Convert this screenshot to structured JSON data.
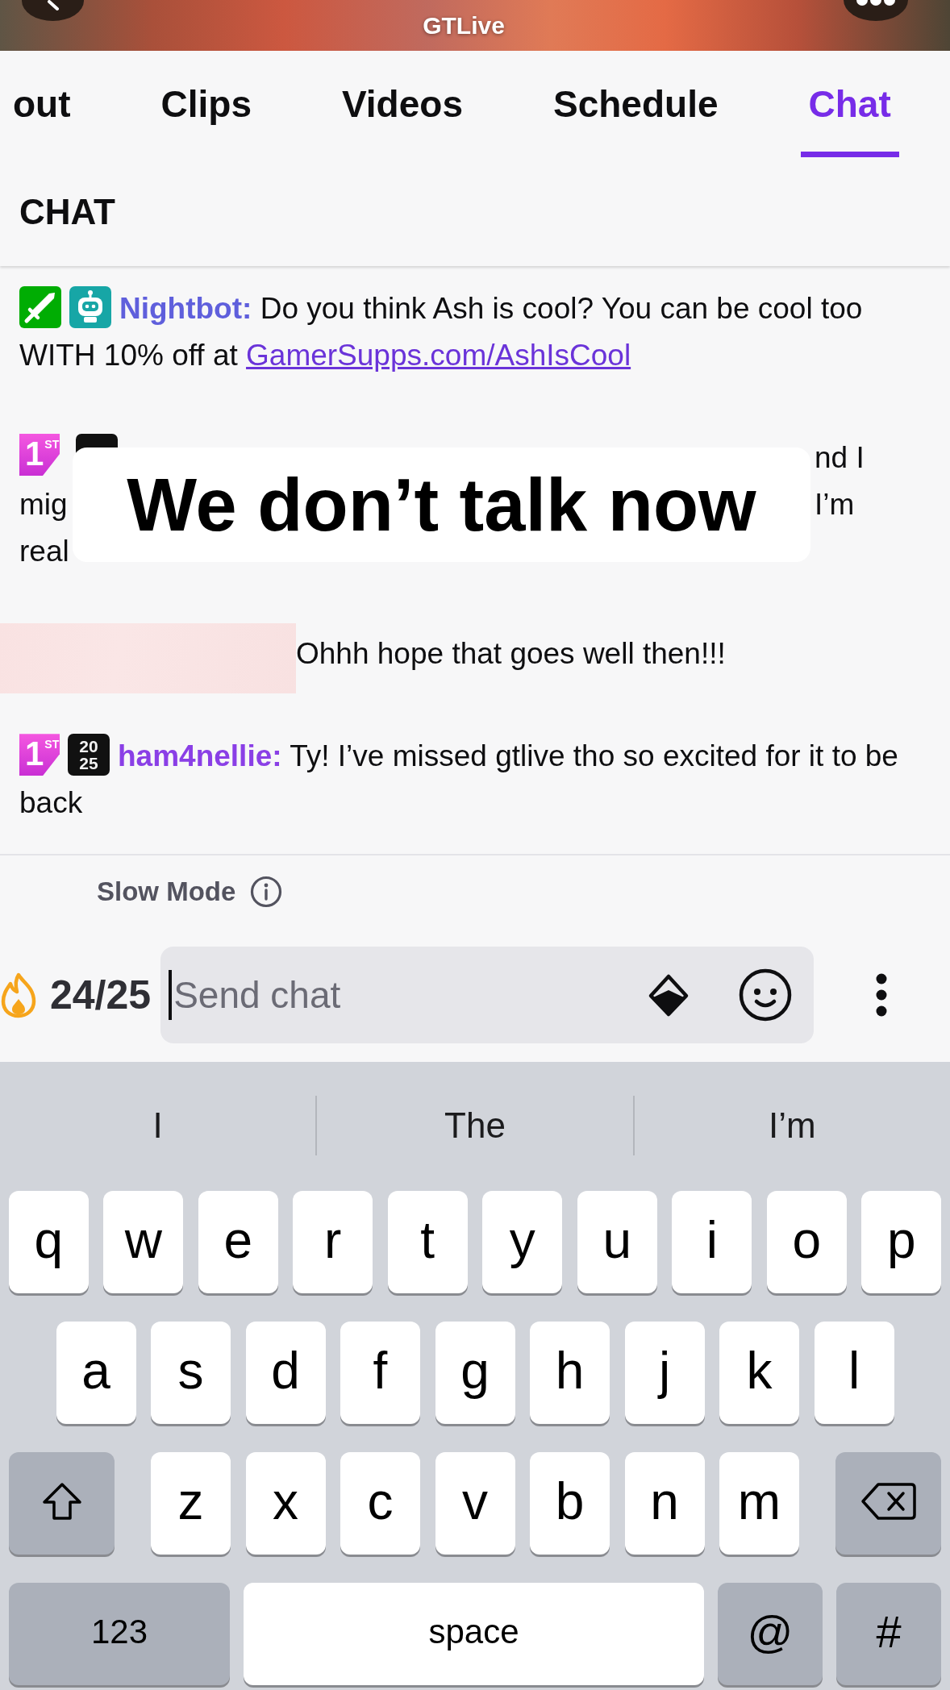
{
  "header": {
    "title": "GTLive"
  },
  "tabs": [
    {
      "label": "out",
      "selected": false
    },
    {
      "label": "Clips",
      "selected": false
    },
    {
      "label": "Videos",
      "selected": false
    },
    {
      "label": "Schedule",
      "selected": false
    },
    {
      "label": "Chat",
      "selected": true
    }
  ],
  "chat_header": {
    "title": "CHAT"
  },
  "messages": [
    {
      "kind": "chat",
      "badges": [
        {
          "kind": "moderator"
        },
        {
          "kind": "bot"
        }
      ],
      "user": "Nightbot:",
      "color": "#5f5fdc",
      "text": "Do you think Ash is cool? You can be cool too WITH 10% off at",
      "link": "GamerSupps.com/AshIsCool"
    },
    {
      "kind": "covered",
      "badges": [
        {
          "kind": "founder",
          "label": "1$^{ST}$"
        },
        {
          "kind": "year"
        }
      ],
      "lines": [
        {
          "right": "nd I"
        },
        {
          "left": "mig",
          "right": "I’m"
        },
        {
          "left": "real"
        }
      ]
    },
    {
      "kind": "redacted",
      "text": "Ohhh hope that goes well then!!!"
    },
    {
      "kind": "chat",
      "badges": [
        {
          "kind": "founder",
          "label": "1$^{ST}$"
        },
        {
          "kind": "year",
          "lines": [
            "20",
            "25"
          ]
        }
      ],
      "user": "ham4nellie:",
      "color": "#8a3fe6",
      "text": "Ty! I’ve missed gtlive tho so excited for it to be back"
    }
  ],
  "caption": {
    "text": "We don’t talk now"
  },
  "slow_mode": {
    "label": "Slow Mode"
  },
  "composer": {
    "counter": "24/25",
    "placeholder": "Send chat",
    "focused": true
  },
  "keyboard": {
    "suggestions": [
      "I",
      "The",
      "I’m"
    ],
    "rows": [
      {
        "kind": "plain",
        "keys": [
          "q",
          "w",
          "e",
          "r",
          "t",
          "y",
          "u",
          "i",
          "o",
          "p"
        ]
      },
      {
        "kind": "plain",
        "keys": [
          "a",
          "s",
          "d",
          "f",
          "g",
          "h",
          "j",
          "k",
          "l"
        ]
      },
      {
        "kind": "shift_row",
        "keys": [
          "z",
          "x",
          "c",
          "v",
          "b",
          "n",
          "m"
        ]
      }
    ],
    "bottom_row": [
      {
        "kind": "mode",
        "label": "123"
      },
      {
        "kind": "space",
        "label": "space"
      },
      {
        "kind": "symbol",
        "label": "@"
      },
      {
        "kind": "symbol",
        "label": "#"
      }
    ]
  }
}
